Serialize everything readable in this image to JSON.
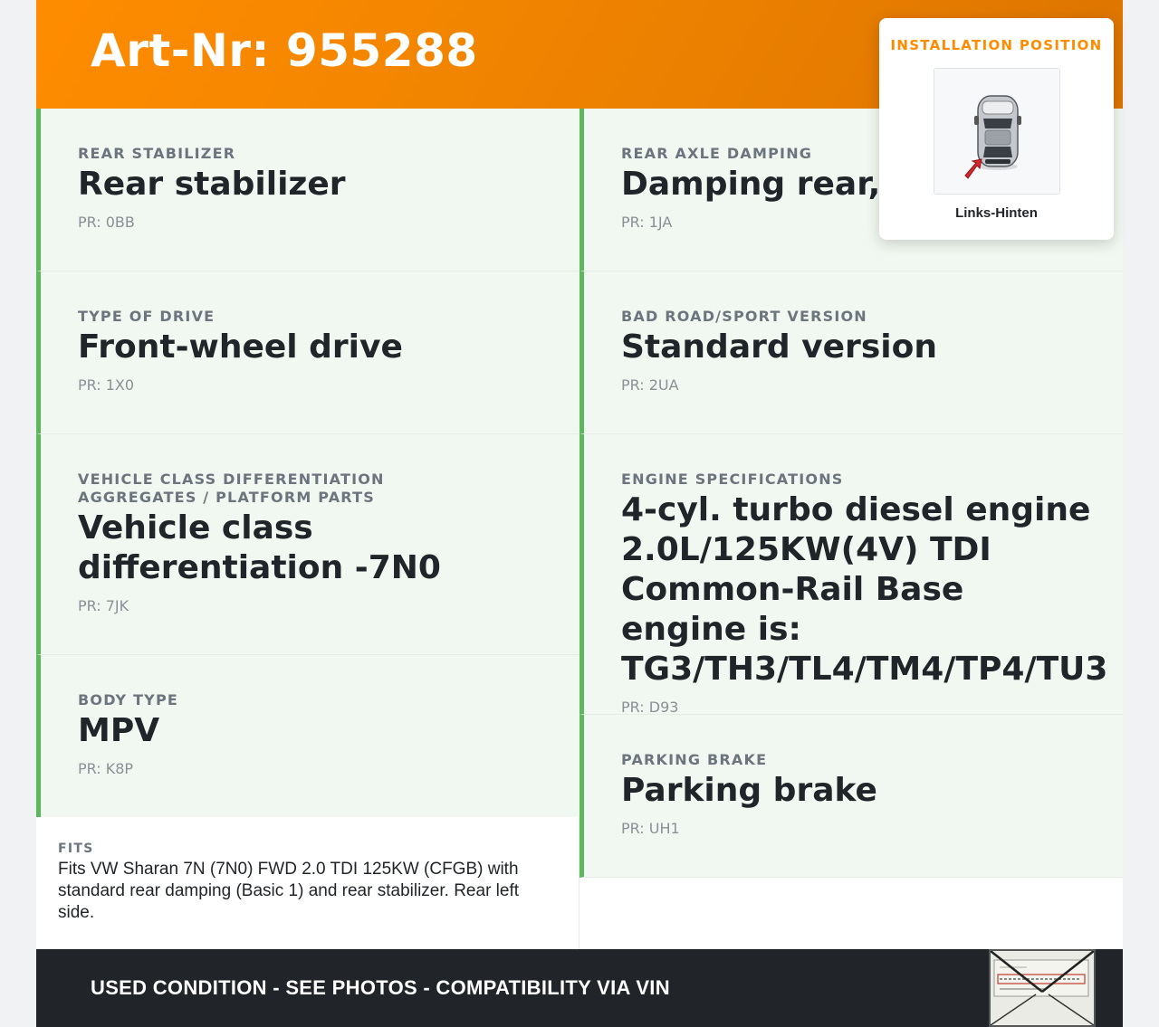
{
  "header": {
    "title": "Art-Nr: 955288"
  },
  "specs_left": [
    {
      "label": "REAR STABILIZER",
      "value": "Rear stabilizer",
      "pr": "PR: 0BB"
    },
    {
      "label": "TYPE OF DRIVE",
      "value": "Front-wheel drive",
      "pr": "PR: 1X0"
    },
    {
      "label": "VEHICLE CLASS DIFFERENTIATION AGGREGATES / PLATFORM PARTS",
      "value": "Vehicle class differentiation -7N0",
      "pr": "PR: 7JK"
    },
    {
      "label": "BODY TYPE",
      "value": "MPV",
      "pr": "PR: K8P"
    }
  ],
  "specs_right": [
    {
      "label": "REAR AXLE DAMPING",
      "value": "Damping rear, ba",
      "pr": "PR: 1JA"
    },
    {
      "label": "BAD ROAD/SPORT VERSION",
      "value": "Standard version",
      "pr": "PR: 2UA"
    },
    {
      "label": "ENGINE SPECIFICATIONS",
      "value": "4-cyl. turbo diesel engine 2.0L/125KW(4V) TDI Common-Rail Base engine is: TG3/TH3/TL4/TM4/TP4/TU3",
      "pr": "PR: D93"
    },
    {
      "label": "PARKING BRAKE",
      "value": "Parking brake",
      "pr": "PR: UH1"
    }
  ],
  "fits": {
    "label": "FITS",
    "text": "Fits VW Sharan 7N (7N0) FWD 2.0 TDI 125KW (CFGB) with standard rear damping (Basic 1) and rear stabilizer. Rear left side."
  },
  "footer": {
    "text": "USED CONDITION - SEE PHOTOS - COMPATIBILITY VIA VIN",
    "image_icon": "vin-plate-photo-icon"
  },
  "installation": {
    "title": "INSTALLATION POSITION",
    "caption": "Links-Hinten",
    "icon": "car-top-view-icon"
  },
  "colors": {
    "accent": "#ff8c00",
    "spec_border": "#5cb85c",
    "spec_bg": "#f1f8f1",
    "footer_bg": "#212529",
    "marker": "#d9262b"
  }
}
